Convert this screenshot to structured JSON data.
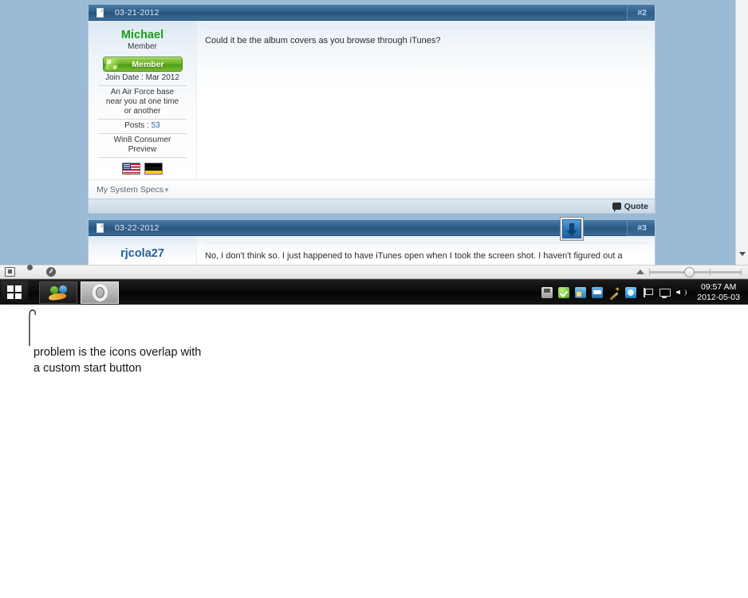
{
  "browser": {
    "background_color": "#9bbad5",
    "posts": [
      {
        "date": "03-21-2012",
        "number": "#2",
        "username": "Michael",
        "username_color": "#18a018",
        "usertitle": "Member",
        "rank_badge": "Member",
        "join_date": "Join Date : Mar 2012",
        "location_line1": "An Air Force base",
        "location_line2": "near you at one time",
        "location_line3": "or another",
        "posts_label": "Posts : ",
        "posts_count": "53",
        "os_line1": "Win8 Consumer",
        "os_line2": "Preview",
        "flags": [
          "us-flag",
          "germany-flag"
        ],
        "message": "Could it be the album covers as you browse through iTunes?",
        "system_specs_label": "My System Specs",
        "quote_label": "Quote"
      },
      {
        "date": "03-22-2012",
        "number": "#3",
        "username": "rjcola27",
        "username_color": "#23619b",
        "message": "No, I don't think so. I just happened to have iTunes open when I took the screen shot. I haven't figured out a"
      }
    ],
    "download_overlay_icon": "download-arrow-icon"
  },
  "statusbar": {
    "icons": [
      "window-icon",
      "cloud-icon",
      "speedometer-icon"
    ],
    "zoom_minus_icon": "zoom-out-icon",
    "zoom_slider_label": "zoom-slider"
  },
  "taskbar": {
    "start_button_icon": "windows-logo-icon",
    "overlap_icon": "overlapping-blue-icon",
    "buttons": [
      {
        "name": "msn-messenger",
        "icon": "msn-messenger-icon",
        "active": false
      },
      {
        "name": "opera-browser",
        "icon": "opera-icon",
        "active": true
      }
    ],
    "tray_icons": [
      "safely-remove-hardware-icon",
      "antivirus-check-icon",
      "network-properties-icon",
      "sync-center-icon",
      "magic-wand-icon",
      "messenger-icon",
      "flag-action-center-icon",
      "display-icon",
      "volume-icon"
    ],
    "clock_time": "09:57 AM",
    "clock_date": "2012-05-03"
  },
  "annotation": {
    "arrow": "up-arrow-pointer",
    "text": "problem is the icons overlap with\na custom start button"
  }
}
